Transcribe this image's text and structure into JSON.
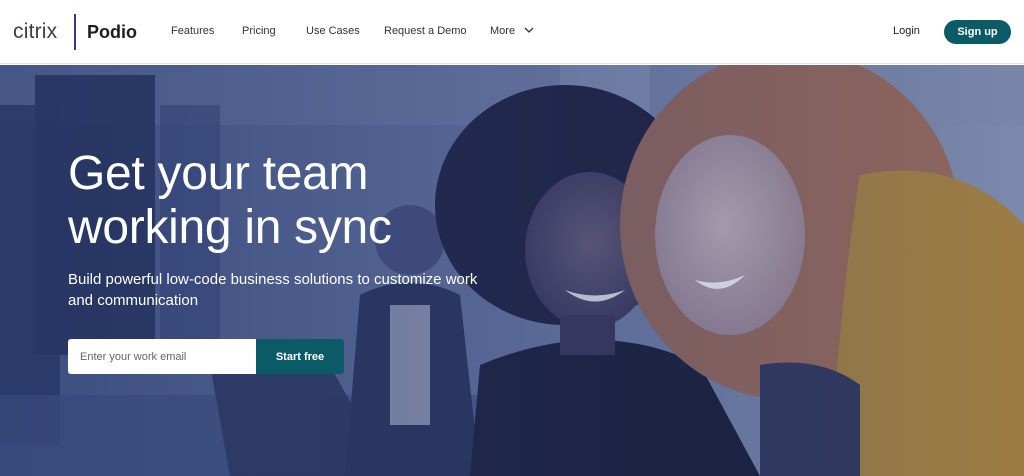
{
  "brand": {
    "company": "citrix",
    "product": "Podio"
  },
  "nav": {
    "items": [
      {
        "label": "Features"
      },
      {
        "label": "Pricing"
      },
      {
        "label": "Use Cases"
      },
      {
        "label": "Request a Demo"
      },
      {
        "label": "More"
      }
    ],
    "more_icon": "chevron-down-icon",
    "login_label": "Login",
    "signup_label": "Sign up"
  },
  "hero": {
    "headline": "Get your team working in sync",
    "subheadline": "Build powerful low-code business solutions to customize work and communication",
    "email_placeholder": "Enter your work email",
    "cta_label": "Start free"
  },
  "colors": {
    "brand_divider": "#4b2d8f",
    "primary_button": "#0b5a67",
    "hero_tint": "#3e4f82"
  }
}
